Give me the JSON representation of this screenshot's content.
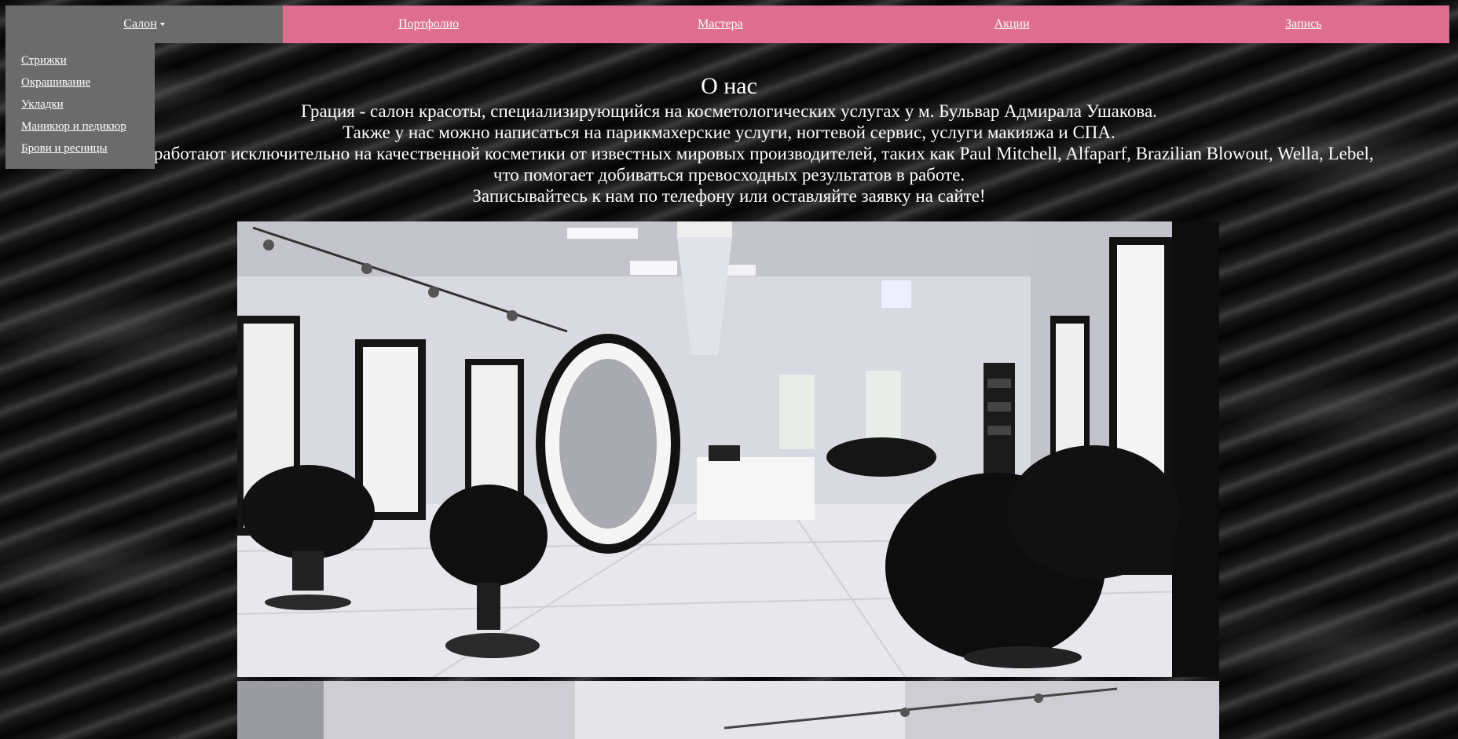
{
  "nav": {
    "items": [
      {
        "label": "Салон"
      },
      {
        "label": "Портфолио"
      },
      {
        "label": "Мастера"
      },
      {
        "label": "Акции"
      },
      {
        "label": "Запись"
      }
    ]
  },
  "dropdown": {
    "items": [
      {
        "label": "Стрижки"
      },
      {
        "label": "Окрашивание"
      },
      {
        "label": "Укладки"
      },
      {
        "label": "Маникюр и педикюр"
      },
      {
        "label": "Брови и ресницы"
      }
    ]
  },
  "about": {
    "title": "О нас",
    "lines": [
      "Грация - салон красоты, специализирующийся на косметологических услугах у м. Бульвар Адмирала Ушакова.",
      "Также у нас можно написаться на парикмахерские услуги, ногтевой сервис, услуги макияжа и СПА.",
      "Мастера работают исключительно на качественной косметики от известных мировых производителей, таких как Paul Mitchell, Alfaparf, Brazilian Blowout, Wella, Lebel,",
      "что помогает добиваться превосходных результатов в работе.",
      "Записывайтесь к нам по телефону или оставляйте заявку на сайте!"
    ]
  },
  "colors": {
    "nav_bg": "#df6d8f",
    "active_bg": "#6b6b6b",
    "text": "#ffffff"
  }
}
